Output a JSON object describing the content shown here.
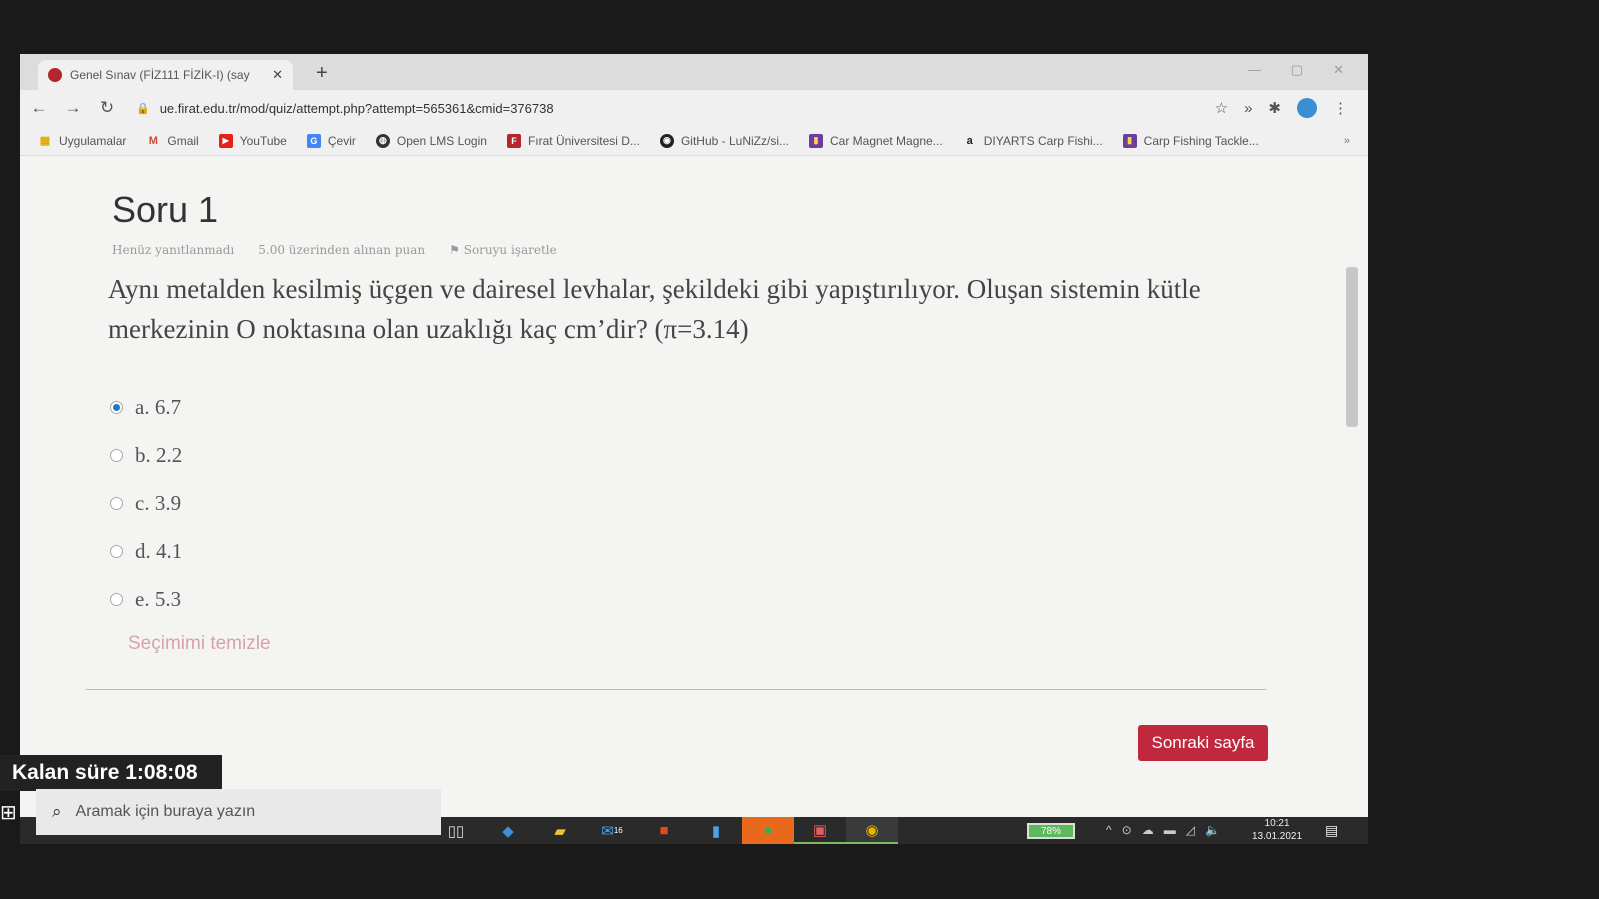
{
  "browser": {
    "tab_title": "Genel Sınav (FİZ111 FİZİK-I) (say",
    "url": "ue.firat.edu.tr/mod/quiz/attempt.php?attempt=565361&cmid=376738"
  },
  "bookmarks": [
    {
      "label": "Uygulamalar",
      "icon": "apps-grid-icon",
      "color": "#e0a800"
    },
    {
      "label": "Gmail",
      "icon": "gmail-icon",
      "color": "#d44638"
    },
    {
      "label": "YouTube",
      "icon": "youtube-icon",
      "color": "#e62117"
    },
    {
      "label": "Çevir",
      "icon": "translate-icon",
      "color": "#4285f4"
    },
    {
      "label": "Open LMS Login",
      "icon": "globe-icon",
      "color": "#333333"
    },
    {
      "label": "Fırat Üniversitesi D...",
      "icon": "firat-logo-icon",
      "color": "#b3262e"
    },
    {
      "label": "GitHub - LuNiZz/si...",
      "icon": "github-icon",
      "color": "#222222"
    },
    {
      "label": "Car Magnet Magne...",
      "icon": "gift-icon",
      "color": "#6a3fa0"
    },
    {
      "label": "DIYARTS Carp Fishi...",
      "icon": "amazon-icon",
      "color": "#222222"
    },
    {
      "label": "Carp Fishing Tackle...",
      "icon": "gift-icon",
      "color": "#6a3fa0"
    }
  ],
  "question": {
    "title": "Soru 1",
    "status": "Henüz yanıtlanmadı",
    "points": "5.00 üzerinden alınan puan",
    "flag": "Soruyu işaretle",
    "text": "Aynı metalden kesilmiş üçgen ve dairesel levhalar, şekildeki gibi yapıştırılıyor. Oluşan sistemin kütle merkezinin O noktasına olan uzaklığı kaç cm’dir? (π=3.14)",
    "options": [
      {
        "label": "a. 6.7",
        "selected": true
      },
      {
        "label": "b. 2.2",
        "selected": false
      },
      {
        "label": "c. 3.9",
        "selected": false
      },
      {
        "label": "d. 4.1",
        "selected": false
      },
      {
        "label": "e. 5.3",
        "selected": false
      }
    ],
    "clear_choice": "Seçimimi temizle",
    "next_page": "Sonraki sayfa"
  },
  "timer": {
    "label": "Kalan süre 1:08:08"
  },
  "taskbar": {
    "search_placeholder": "Aramak için buraya yazın",
    "battery": "78%",
    "time": "10:21",
    "date": "13.01.2021",
    "mail_badge": "16"
  }
}
